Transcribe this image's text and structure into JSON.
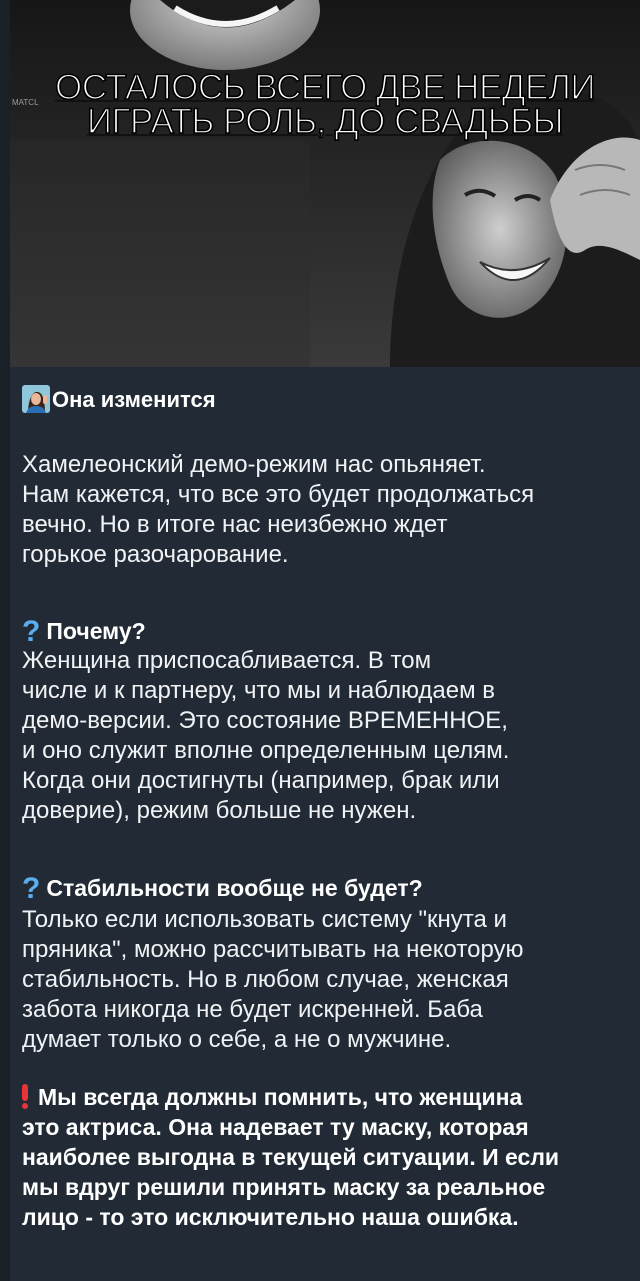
{
  "image": {
    "caption_line1": "ОСТАЛОСЬ ВСЕГО ДВЕ НЕДЕЛИ",
    "caption_line2": "ИГРАТЬ РОЛЬ, ДО СВАДЬБЫ",
    "watermark": "MATCL"
  },
  "post": {
    "title": "Она изменится",
    "intro": [
      "Хамелеонский демо-режим нас опьяняет.",
      "Нам кажется, что все это будет продолжаться",
      "вечно. Но в итоге нас неизбежно ждет",
      "горькое разочарование."
    ],
    "section1": {
      "heading": "Почему?",
      "lines": [
        "Женщина приспосабливается. В том",
        "числе и к партнеру, что мы и наблюдаем в",
        "демо-версии. Это состояние ВРЕМЕННОЕ,",
        "и оно служит вполне определенным целям.",
        "Когда они достигнуты (например, брак или",
        "доверие), режим больше не нужен."
      ]
    },
    "section2": {
      "heading": "Стабильности вообще не будет?",
      "lines": [
        "Только если использовать систему \"кнута и",
        "пряника\", можно рассчитывать на некоторую",
        "стабильность. Но в любом случае, женская",
        "забота никогда не будет искренней. Баба",
        "думает только о себе, а не о мужчине."
      ]
    },
    "section3": {
      "lines": [
        "Мы всегда должны помнить, что женщина",
        "это актриса. Она надевает ту маску, которая",
        "наиболее выгодна в текущей ситуации. И если",
        "мы вдруг решили принять маску за реальное",
        "лицо - то это исключительно наша ошибка."
      ]
    }
  },
  "colors": {
    "background": "#222b35",
    "question_mark": "#5aaef0",
    "exclamation": "#e8333a"
  }
}
